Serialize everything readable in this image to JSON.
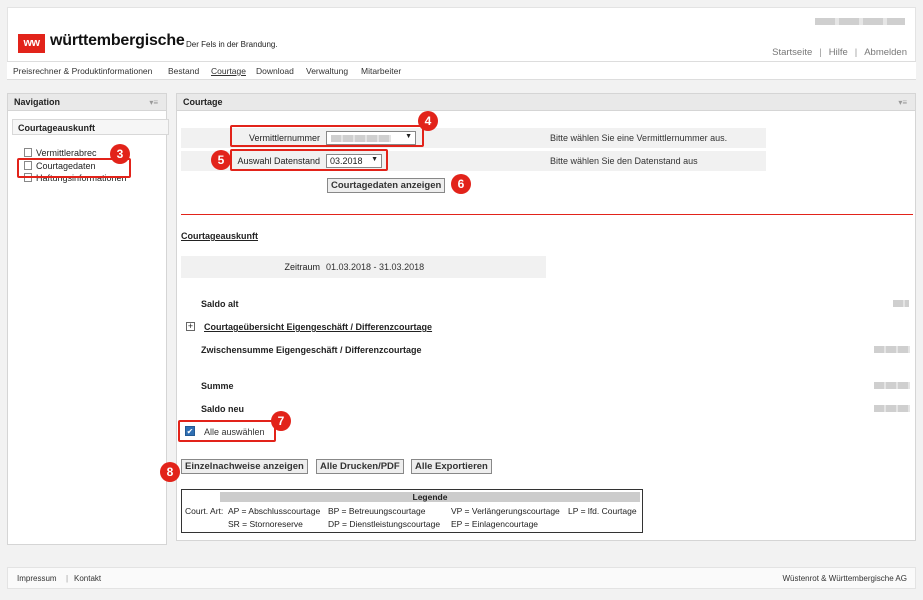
{
  "header": {
    "logo": "ww",
    "brand": "württembergische",
    "slogan": "Der Fels in der Brandung.",
    "links": [
      "Startseite",
      "Hilfe",
      "Abmelden"
    ],
    "sep": "|"
  },
  "menu": [
    "Preisrechner & Produktinformationen",
    "Bestand",
    "Courtage",
    "Download",
    "Verwaltung",
    "Mitarbeiter"
  ],
  "nav": {
    "title": "Navigation",
    "ctl": "▾≡",
    "section": "Courtageauskunft",
    "items": [
      "Vermittlerabrec",
      "Courtagedaten",
      "Haftungsinformationen"
    ]
  },
  "main": {
    "title": "Courtage",
    "ctl": "▾≡",
    "vermittler_label": "Vermittlernummer",
    "vermittler_hint": "Bitte wählen Sie eine Vermittlernummer aus.",
    "datenstand_label": "Auswahl Datenstand",
    "datenstand_value": "03.2018",
    "datenstand_hint": "Bitte wählen Sie den Datenstand aus",
    "show_button": "Courtagedaten anzeigen",
    "section": "Courtageauskunft",
    "zeitraum_label": "Zeitraum",
    "zeitraum_value": "01.03.2018 - 31.03.2018",
    "saldo_alt": "Saldo alt",
    "expand": "+",
    "uebersicht": "Courtageübersicht Eigengeschäft / Differenzcourtage",
    "zwischensumme": "Zwischensumme Eigengeschäft / Differenzcourtage",
    "summe": "Summe",
    "saldo_neu": "Saldo neu",
    "alle_auswaehlen": "Alle auswählen",
    "btn_einzel": "Einzelnachweise anzeigen",
    "btn_drucken": "Alle Drucken/PDF",
    "btn_export": "Alle Exportieren"
  },
  "legend": {
    "title": "Legende",
    "prefix": "Court. Art:",
    "line1": [
      "AP = Abschlusscourtage",
      "BP = Betreuungscourtage",
      "VP = Verlängerungscourtage",
      "LP = lfd. Courtage"
    ],
    "line2": [
      "SR = Stornoreserve",
      "DP = Dienstleistungscourtage",
      "EP = Einlagencourtage"
    ]
  },
  "badges": [
    "3",
    "4",
    "5",
    "6",
    "7",
    "8"
  ],
  "footer": {
    "links": [
      "Impressum",
      "Kontakt"
    ],
    "sep": "|",
    "company": "Wüstenrot & Württembergische AG"
  },
  "colors": {
    "accent": "#e2231a"
  }
}
